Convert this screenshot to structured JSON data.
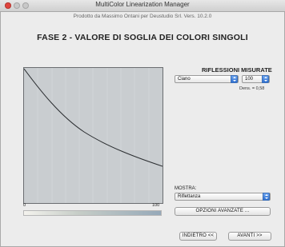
{
  "window": {
    "title": "MultiColor Linearization Manager",
    "subtitle": "Prodotto da Massimo Ontani per Deustudio Srl. Vers. 10.2.0"
  },
  "phase_title": "FASE 2 - VALORE DI SOGLIA DEI COLORI SINGOLI",
  "graph": {
    "axis_min_label": "0",
    "axis_max_label": "100"
  },
  "measurements": {
    "label": "RIFLESSIONI MISURATE",
    "color_select": "Ciano",
    "value_select": "100",
    "density_text": "Dens. = 0,58"
  },
  "display": {
    "label": "MOSTRA:",
    "select": "Riflettanza",
    "advanced_button": "OPZIONI AVANZATE ..."
  },
  "nav": {
    "back_button": "INDIETRO <<",
    "next_button": "AVANTI >>"
  },
  "colors": {
    "close_button": "#e0443e",
    "accent_select": "#2e6fd0",
    "graph_background": "#c9cdd0"
  }
}
